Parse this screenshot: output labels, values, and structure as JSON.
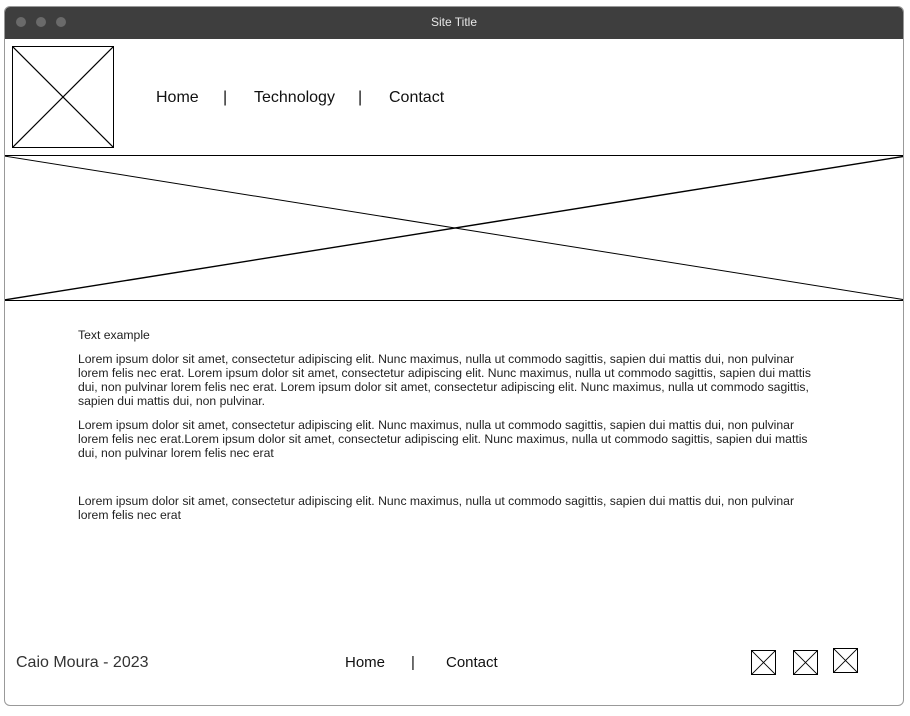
{
  "window": {
    "title": "Site Title"
  },
  "header": {
    "logo_icon": "image-placeholder-icon",
    "nav": [
      "Home",
      "Technology",
      "Contact"
    ],
    "separator": "|"
  },
  "hero": {
    "icon": "image-placeholder-icon"
  },
  "main": {
    "heading": "Text example",
    "paragraphs": [
      "Lorem ipsum dolor sit amet, consectetur adipiscing elit. Nunc maximus, nulla ut commodo sagittis, sapien dui mattis dui, non pulvinar lorem felis nec erat. Lorem ipsum dolor sit amet, consectetur adipiscing elit. Nunc maximus, nulla ut commodo sagittis, sapien dui mattis dui, non pulvinar lorem felis nec erat. Lorem ipsum dolor sit amet, consectetur adipiscing elit. Nunc maximus, nulla ut commodo sagittis, sapien dui mattis dui, non pulvinar.",
      "Lorem ipsum dolor sit amet, consectetur adipiscing elit. Nunc maximus, nulla ut commodo sagittis, sapien dui mattis dui, non pulvinar lorem felis nec erat.Lorem ipsum dolor sit amet, consectetur adipiscing elit. Nunc maximus, nulla ut commodo sagittis, sapien dui mattis dui, non pulvinar lorem felis nec erat",
      "Lorem ipsum dolor sit amet, consectetur adipiscing elit. Nunc maximus, nulla ut commodo sagittis, sapien dui mattis dui, non pulvinar lorem felis nec erat"
    ]
  },
  "footer": {
    "copyright": "Caio Moura - 2023",
    "nav": [
      "Home",
      "Contact"
    ],
    "separator": "|",
    "social_icons": [
      "image-placeholder-icon",
      "image-placeholder-icon",
      "image-placeholder-icon"
    ]
  },
  "colors": {
    "titlebar": "#3e3e3e",
    "border": "#000000"
  }
}
